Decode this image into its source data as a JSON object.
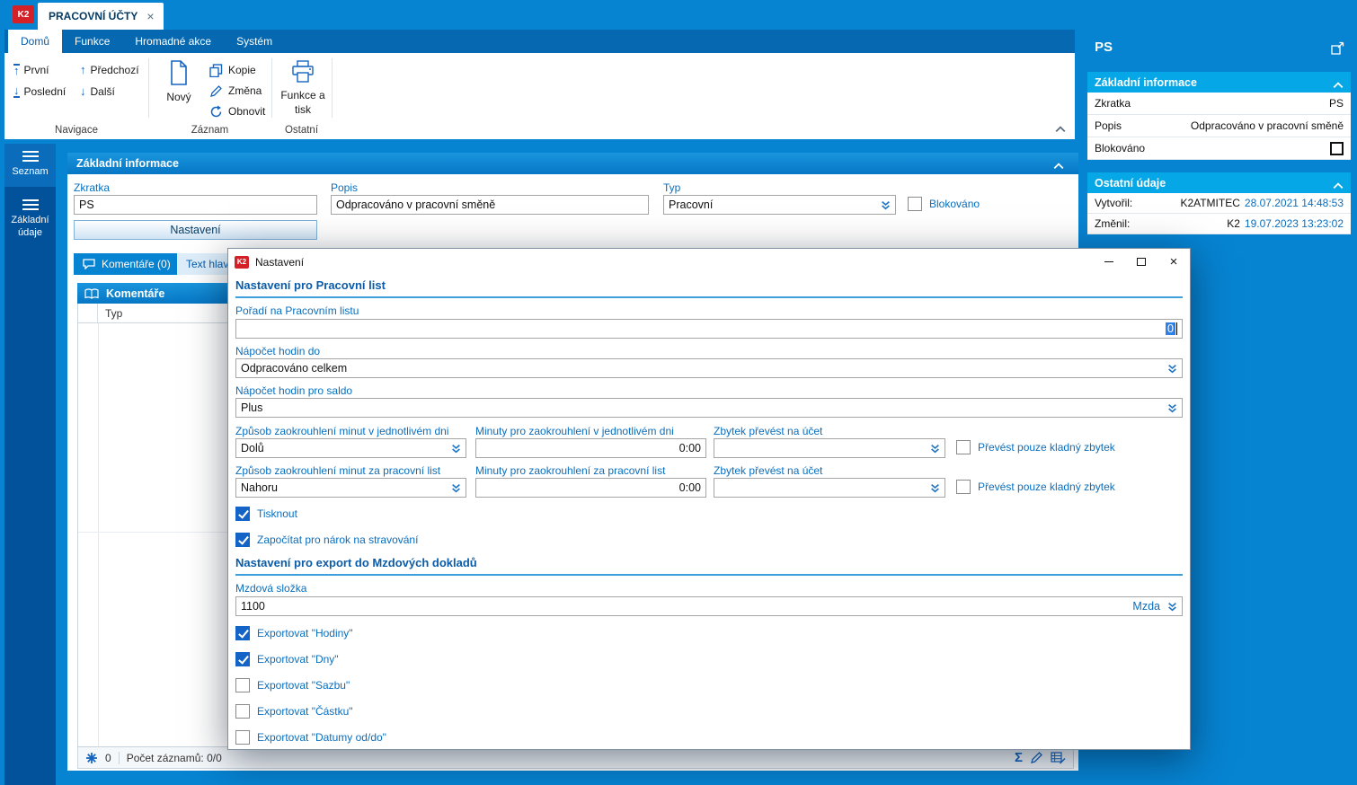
{
  "colors": {
    "chrome": "#0683d1",
    "cyan_header": "#06a7e7",
    "accent": "#0a6ebd",
    "check_fill": "#1464c8",
    "k2_red": "#d42027"
  },
  "icons": {
    "up_arrow": "↑",
    "down_arrow": "↓",
    "sum": "Σ",
    "close": "×"
  },
  "titlebar": {
    "app_button": "K2",
    "tab": "PRACOVNÍ ÚČTY"
  },
  "ribbon": {
    "tabs": [
      {
        "label": "Domů"
      },
      {
        "label": "Funkce"
      },
      {
        "label": "Hromadné akce"
      },
      {
        "label": "Systém"
      }
    ],
    "buttons": {
      "prvni": "První",
      "posledni": "Poslední",
      "predchozi": "Předchozí",
      "dalsi": "Další",
      "novy": "Nový",
      "kopie": "Kopie",
      "zmena": "Změna",
      "obnovit": "Obnovit",
      "funkce_a_tisk": "Funkce a tisk"
    },
    "groups": {
      "navigace": "Navigace",
      "zaznam": "Záznam",
      "ostatni": "Ostatní"
    }
  },
  "sidebar": {
    "items": [
      {
        "label": "Seznam"
      },
      {
        "label": "Základní údaje"
      }
    ]
  },
  "main": {
    "header": "Základní informace",
    "zkratka_label": "Zkratka",
    "zkratka_value": "PS",
    "popis_label": "Popis",
    "popis_value": "Odpracováno v pracovní směně",
    "typ_label": "Typ",
    "typ_value": "Pracovní",
    "blokovano_label": "Blokováno",
    "nastaveni_button": "Nastavení",
    "tab_komentare": "Komentáře (0)",
    "tab_text": "Text hlav",
    "komentare_header": "Komentáře",
    "typ_column": "Typ",
    "status_count": "0",
    "status_records": "Počet záznamů: 0/0"
  },
  "right_panel": {
    "title": "PS",
    "basic_header": "Základní informace",
    "rows": [
      {
        "label": "Zkratka",
        "value": "PS"
      },
      {
        "label": "Popis",
        "value": "Odpracováno v pracovní směně"
      },
      {
        "label": "Blokováno",
        "value": ""
      }
    ],
    "other_header": "Ostatní údaje",
    "audit": [
      {
        "label": "Vytvořil:",
        "user": "K2ATMITEC",
        "date": "28.07.2021 14:48:53"
      },
      {
        "label": "Změnil:",
        "user": "K2",
        "date": "19.07.2023 13:23:02"
      }
    ]
  },
  "dialog": {
    "title": "Nastavení",
    "section1": "Nastavení pro Pracovní list",
    "section2": "Nastavení pro export do Mzdových dokladů",
    "poradi_label": "Pořadí na Pracovním listu",
    "poradi_value": "0",
    "napocet_label": "Nápočet hodin do",
    "napocet_value": "Odpracováno celkem",
    "saldo_label": "Nápočet hodin pro saldo",
    "saldo_value": "Plus",
    "row1": {
      "zpusob_label": "Způsob zaokrouhlení minut v jednotlivém dni",
      "zpusob_value": "Dolů",
      "minuty_label": "Minuty pro zaokrouhlení v jednotlivém dni",
      "minuty_value": "0:00",
      "zbytek_label": "Zbytek převést na účet",
      "prevest_label": "Převést pouze kladný zbytek",
      "prevest_checked": false
    },
    "row2": {
      "zpusob_label": "Způsob zaokrouhlení minut za pracovní list",
      "zpusob_value": "Nahoru",
      "minuty_label": "Minuty pro zaokrouhlení za pracovní list",
      "minuty_value": "0:00",
      "zbytek_label": "Zbytek převést na účet",
      "prevest_label": "Převést pouze kladný zbytek",
      "prevest_checked": false
    },
    "checkboxes": [
      {
        "label": "Tisknout",
        "checked": true
      },
      {
        "label": "Započítat pro nárok na stravování",
        "checked": true
      }
    ],
    "mzdova_label": "Mzdová složka",
    "mzdova_value": "1100",
    "mzda_tag": "Mzda",
    "export_checkboxes": [
      {
        "label": "Exportovat \"Hodiny\"",
        "checked": true
      },
      {
        "label": "Exportovat \"Dny\"",
        "checked": true
      },
      {
        "label": "Exportovat \"Sazbu\"",
        "checked": false
      },
      {
        "label": "Exportovat \"Částku\"",
        "checked": false
      },
      {
        "label": "Exportovat \"Datumy od/do\"",
        "checked": false
      }
    ]
  }
}
